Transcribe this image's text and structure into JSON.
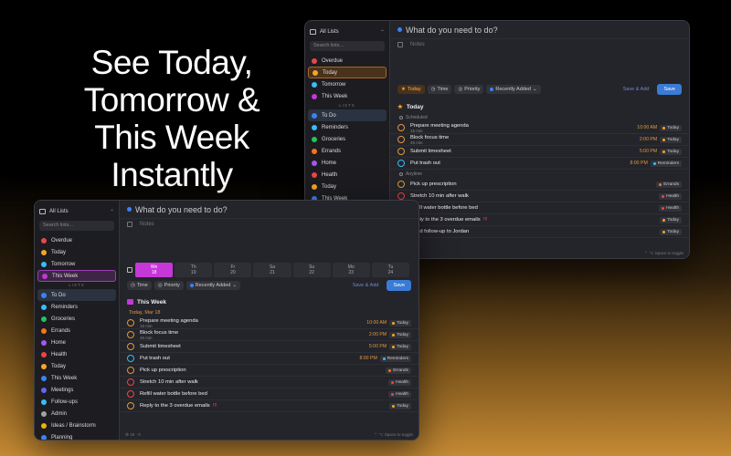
{
  "headline": "See Today,\nTomorrow &\nThis Week\nInstantly",
  "back": {
    "sidebar": {
      "header": "All Lists",
      "search_placeholder": "Search lists...",
      "smart": [
        {
          "label": "Overdue",
          "color": "#e5484d",
          "selected": false
        },
        {
          "label": "Today",
          "color": "#f5a524",
          "selected": true
        },
        {
          "label": "Tomorrow",
          "color": "#38bdf8",
          "selected": false
        },
        {
          "label": "This Week",
          "color": "#c637d8",
          "selected": false
        }
      ],
      "section_label": "LISTS",
      "lists": [
        {
          "label": "To Do",
          "color": "#3b82f6",
          "selected": true
        },
        {
          "label": "Reminders",
          "color": "#38bdf8"
        },
        {
          "label": "Groceries",
          "color": "#22c55e"
        },
        {
          "label": "Errands",
          "color": "#f97316"
        },
        {
          "label": "Home",
          "color": "#a855f7"
        },
        {
          "label": "Health",
          "color": "#ef4444"
        },
        {
          "label": "Today",
          "color": "#f5a524"
        },
        {
          "label": "This Week",
          "color": "#3b82f6"
        }
      ]
    },
    "input_placeholder": "What do you need to do?",
    "notes_placeholder": "Notes",
    "chips": [
      "Today",
      "Time",
      "Priority",
      "Recently Added"
    ],
    "save_add": "Save & Add",
    "save": "Save",
    "section_title": "Today",
    "scheduled_label": "Scheduled",
    "anytime_label": "Anytime",
    "scheduled": [
      {
        "title": "Prepare meeting agenda",
        "dur": "15 min",
        "time": "10:00 AM",
        "tag": "Today",
        "tagc": "#f5a524",
        "circ": "#e09a3a"
      },
      {
        "title": "Block focus time",
        "dur": "45 min",
        "time": "2:00 PM",
        "tag": "Today",
        "tagc": "#f5a524",
        "circ": "#e09a3a"
      },
      {
        "title": "Submit timesheet",
        "dur": "",
        "time": "5:00 PM",
        "tag": "Today",
        "tagc": "#f5a524",
        "circ": "#e09a3a"
      },
      {
        "title": "Put trash out",
        "dur": "",
        "time": "8:00 PM",
        "tag": "Reminders",
        "tagc": "#38bdf8",
        "circ": "#38bdf8"
      }
    ],
    "anytime": [
      {
        "title": "Pick up prescription",
        "tag": "Errands",
        "tagc": "#f97316",
        "circ": "#e09a3a"
      },
      {
        "title": "Stretch 10 min after walk",
        "tag": "Health",
        "tagc": "#ef4444",
        "circ": "#ef4444"
      },
      {
        "title": "Refill water bottle before bed",
        "tag": "Health",
        "tagc": "#ef4444",
        "circ": "#ef4444"
      },
      {
        "title": "Reply to the 3 overdue emails",
        "flag": "!!!",
        "tag": "Today",
        "tagc": "#f5a524",
        "circ": "#e09a3a"
      },
      {
        "title": "Send follow-up to Jordan",
        "tag": "Today",
        "tagc": "#f5a524",
        "circ": "#e09a3a"
      }
    ],
    "footer": "⌃ ⌥ Space to toggle"
  },
  "front": {
    "sidebar": {
      "header": "All Lists",
      "search_placeholder": "Search lists...",
      "smart": [
        {
          "label": "Overdue",
          "color": "#e5484d"
        },
        {
          "label": "Today",
          "color": "#f5a524"
        },
        {
          "label": "Tomorrow",
          "color": "#38bdf8"
        },
        {
          "label": "This Week",
          "color": "#c637d8",
          "selected": true
        }
      ],
      "section_label": "LISTS",
      "lists": [
        {
          "label": "To Do",
          "color": "#3b82f6",
          "selected": true
        },
        {
          "label": "Reminders",
          "color": "#38bdf8"
        },
        {
          "label": "Groceries",
          "color": "#22c55e"
        },
        {
          "label": "Errands",
          "color": "#f97316"
        },
        {
          "label": "Home",
          "color": "#a855f7"
        },
        {
          "label": "Health",
          "color": "#ef4444"
        },
        {
          "label": "Today",
          "color": "#f5a524"
        },
        {
          "label": "This Week",
          "color": "#3b82f6"
        },
        {
          "label": "Meetings",
          "color": "#6366f1"
        },
        {
          "label": "Follow-ups",
          "color": "#38bdf8"
        },
        {
          "label": "Admin",
          "color": "#a3a3a3"
        },
        {
          "label": "Ideas / Brainstorm",
          "color": "#eab308"
        },
        {
          "label": "Planning",
          "color": "#3b82f6"
        }
      ]
    },
    "input_placeholder": "What do you need to do?",
    "notes_placeholder": "Notes",
    "days": [
      {
        "d": "We",
        "n": "18",
        "sel": true
      },
      {
        "d": "Th",
        "n": "19"
      },
      {
        "d": "Fr",
        "n": "20"
      },
      {
        "d": "Sa",
        "n": "21"
      },
      {
        "d": "Su",
        "n": "22"
      },
      {
        "d": "Mo",
        "n": "23"
      },
      {
        "d": "Tu",
        "n": "24"
      }
    ],
    "chips": [
      "Time",
      "Priority",
      "Recently Added"
    ],
    "save_add": "Save & Add",
    "save": "Save",
    "section_title": "This Week",
    "today_sub": "Today, Mar 18",
    "tasks": [
      {
        "title": "Prepare meeting agenda",
        "dur": "15 min",
        "time": "10:00 AM",
        "tag": "Today",
        "tagc": "#f5a524",
        "circ": "#e09a3a"
      },
      {
        "title": "Block focus time",
        "dur": "45 min",
        "time": "2:00 PM",
        "tag": "Today",
        "tagc": "#f5a524",
        "circ": "#e09a3a"
      },
      {
        "title": "Submit timesheet",
        "dur": "",
        "time": "5:00 PM",
        "tag": "Today",
        "tagc": "#f5a524",
        "circ": "#e09a3a"
      },
      {
        "title": "Put trash out",
        "dur": "",
        "time": "8:00 PM",
        "tag": "Reminders",
        "tagc": "#38bdf8",
        "circ": "#38bdf8"
      },
      {
        "title": "Pick up prescription",
        "time": "",
        "tag": "Errands",
        "tagc": "#f97316",
        "circ": "#e09a3a"
      },
      {
        "title": "Stretch 10 min after walk",
        "time": "",
        "tag": "Health",
        "tagc": "#ef4444",
        "circ": "#ef4444"
      },
      {
        "title": "Refill water bottle before bed",
        "time": "",
        "tag": "Health",
        "tagc": "#ef4444",
        "circ": "#ef4444"
      },
      {
        "title": "Reply to the 3 overdue emails",
        "flag": "!!!",
        "time": "",
        "tag": "Today",
        "tagc": "#f5a524",
        "circ": "#e09a3a"
      }
    ],
    "footer_left": "⚙ 18 · 0",
    "footer": "⌃ ⌥ Space to toggle"
  }
}
